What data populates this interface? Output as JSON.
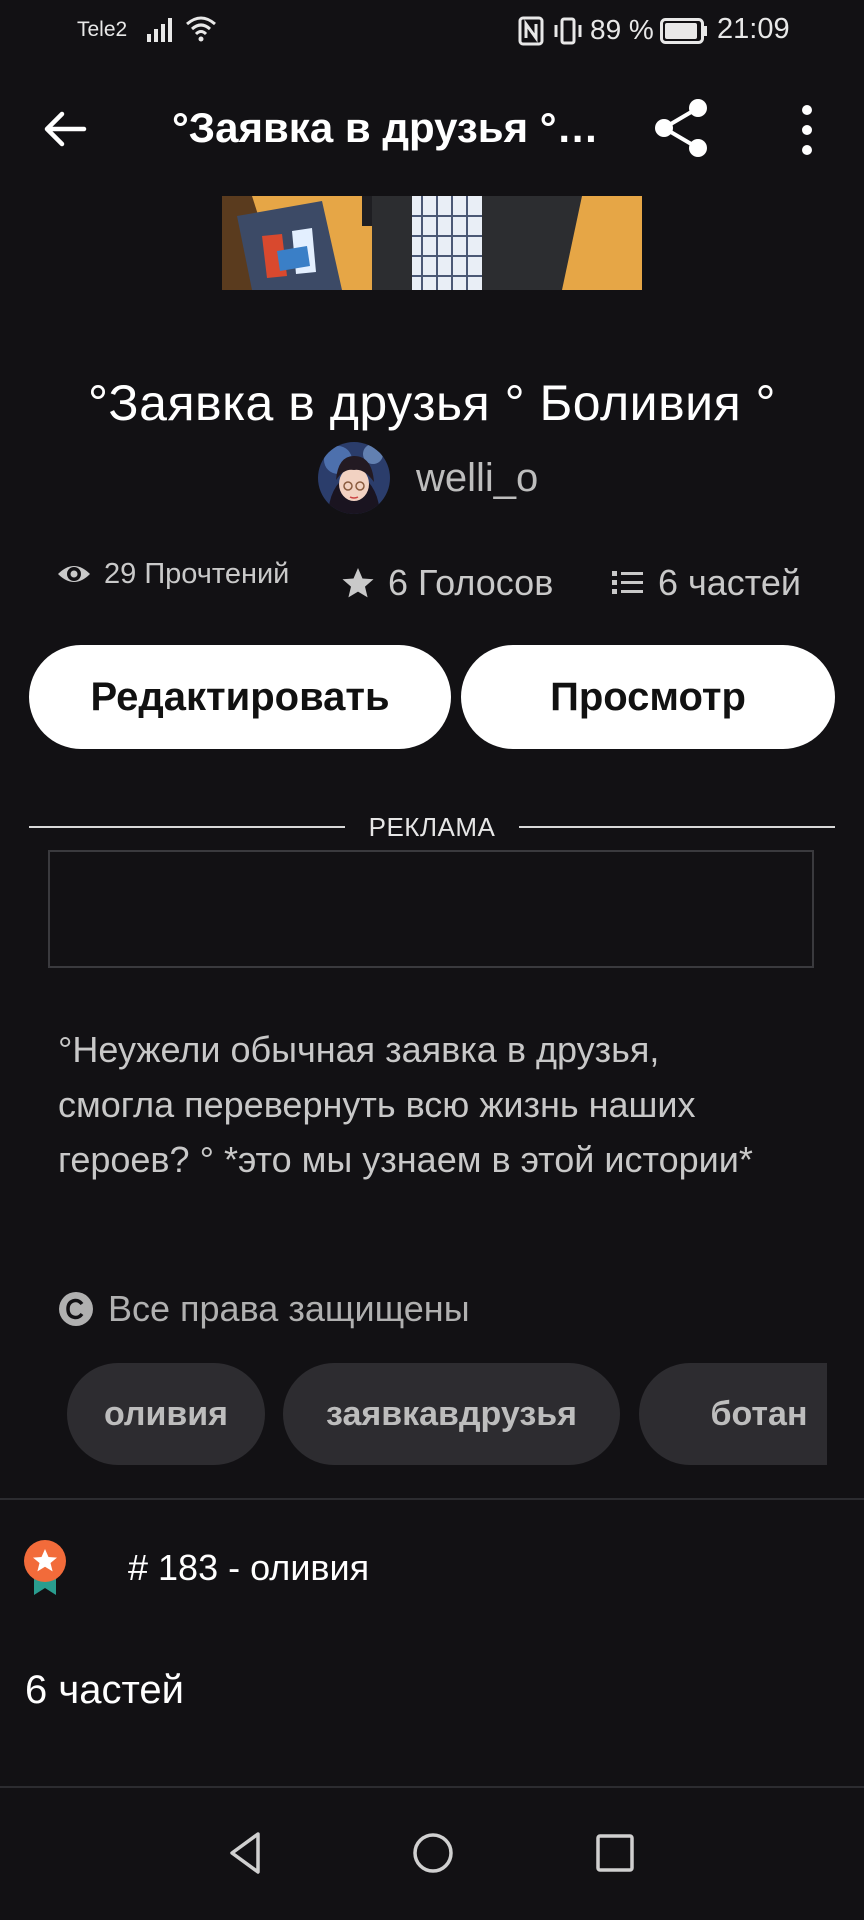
{
  "status_bar": {
    "carrier": "Tele2",
    "battery_percent": "89 %",
    "time": "21:09"
  },
  "app_bar": {
    "title": "°Заявка в друзья ° Боливия °",
    "icons": [
      "arrow-back-icon",
      "share-icon",
      "more-vert-icon"
    ]
  },
  "story": {
    "title": "°Заявка в друзья ° Боливия °",
    "author": "welli_o",
    "reads": "29 Прочтений",
    "votes": "6 Голосов",
    "parts": "6 частей"
  },
  "actions": {
    "edit_label": "Редактировать",
    "view_label": "Просмотр"
  },
  "ad": {
    "label": "РЕКЛАМА"
  },
  "description": "°Неужели обычная заявка в друзья, смогла перевернуть всю жизнь наших героев? ° *это мы узнаем в этой истории*",
  "copyright": "Все права защищены",
  "tags": [
    "оливия",
    "заявкавдрузья",
    "ботан"
  ],
  "ranking": {
    "label": "# 183 - оливия",
    "badge_color": "#f26b3a",
    "ribbon_color": "#2a9d8f"
  },
  "parts_heading": "6 частей",
  "colors": {
    "background": "#121114",
    "button_bg": "#ffffff",
    "tag_bg": "#2d2c30",
    "secondary_text": "#c9c9c9"
  }
}
